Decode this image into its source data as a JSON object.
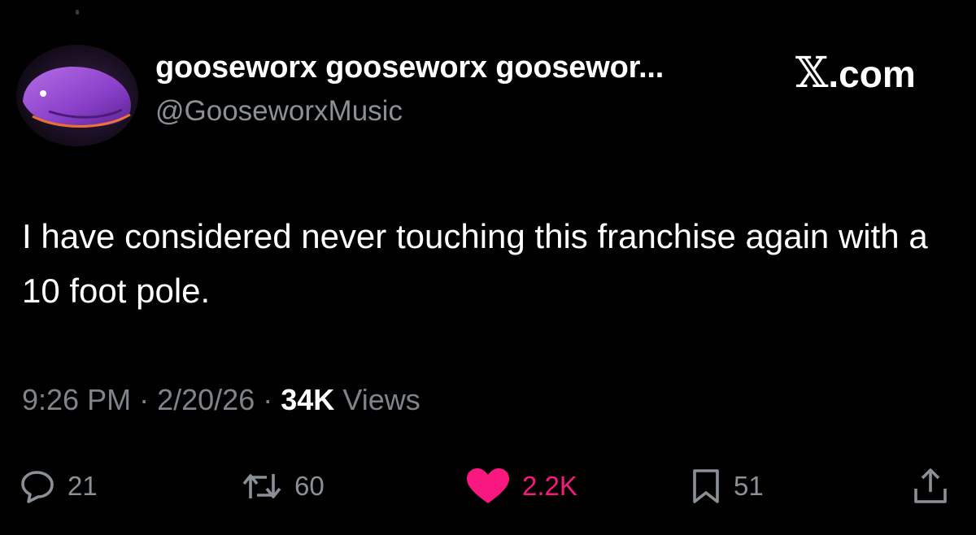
{
  "author": {
    "display_name": "gooseworx gooseworx goosewor...",
    "handle": "@GooseworxMusic"
  },
  "brand": {
    "x_glyph": "𝕏",
    "suffix": ".com"
  },
  "tweet": {
    "text": "I have considered never touching this franchise again with a 10 foot pole."
  },
  "meta": {
    "time": "9:26 PM",
    "separator": "·",
    "date": "2/20/26",
    "views_count": "34K",
    "views_label": "Views"
  },
  "actions": {
    "replies": "21",
    "reposts": "60",
    "likes": "2.2K",
    "bookmarks": "51"
  },
  "colors": {
    "background": "#000000",
    "text": "#ffffff",
    "muted": "#8b9096",
    "like": "#f91880"
  },
  "icons": {
    "reply": "speech-bubble-icon",
    "repost": "repost-arrows-icon",
    "like": "heart-icon",
    "bookmark": "bookmark-icon",
    "share": "share-upload-icon"
  }
}
